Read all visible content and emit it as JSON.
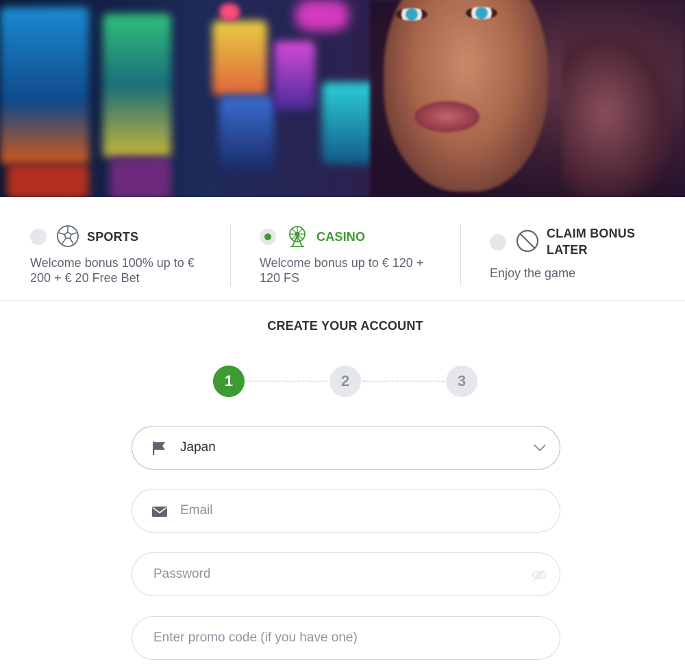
{
  "hero": {
    "image": "casino-hero-banner"
  },
  "bonus_options": [
    {
      "id": "sports",
      "title": "SPORTS",
      "description": "Welcome bonus 100% up to € 200 + € 20 Free Bet",
      "icon": "soccer-ball-icon",
      "selected": false
    },
    {
      "id": "casino",
      "title": "CASINO",
      "description": "Welcome bonus up to € 120 + 120 FS",
      "icon": "ferris-wheel-icon",
      "selected": true
    },
    {
      "id": "later",
      "title": "CLAIM BONUS LATER",
      "description": "Enjoy the game",
      "icon": "no-bonus-icon",
      "selected": false
    }
  ],
  "form": {
    "title": "CREATE YOUR ACCOUNT",
    "steps": [
      "1",
      "2",
      "3"
    ],
    "active_step": 1,
    "country": {
      "value": "Japan",
      "icon": "flag-icon"
    },
    "email": {
      "placeholder": "Email",
      "icon": "envelope-icon"
    },
    "password": {
      "placeholder": "Password",
      "icon": "eye-hidden-icon"
    },
    "promo": {
      "placeholder": "Enter promo code (if you have one)"
    }
  },
  "colors": {
    "accent_green": "#3e9b32",
    "text_dark": "#2e3035",
    "text_muted": "#5d6573",
    "placeholder": "#8d939f",
    "border": "#d9dbe1",
    "step_inactive_bg": "#e6e7ec"
  }
}
